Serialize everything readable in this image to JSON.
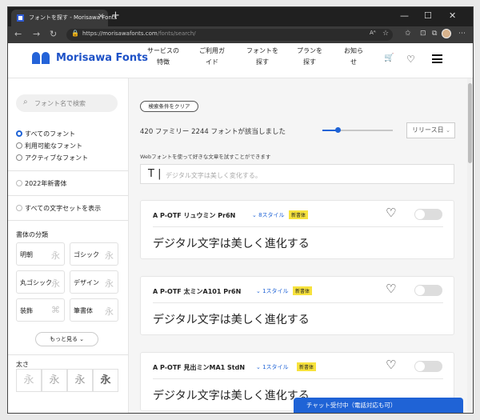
{
  "browser": {
    "tab_title": "フォントを探す - Morisawa Fonts",
    "tab_close": "×",
    "new_tab": "+",
    "win_min": "—",
    "win_max": "☐",
    "win_close": "✕",
    "back": "←",
    "forward": "→",
    "reload": "↻",
    "url_host": "https://morisawafonts.com",
    "url_path": "/fonts/search/",
    "lock": "🔒",
    "read_aloud": "Aᴬ",
    "star": "☆",
    "collections": "⊡",
    "favorites": "✩",
    "extensions": "⧉",
    "more": "⋯"
  },
  "header": {
    "logo_text": "Morisawa Fonts",
    "menu": [
      {
        "line1": "サービスの",
        "line2": "特徴"
      },
      {
        "line1": "ご利用ガ",
        "line2": "イド"
      },
      {
        "line1": "フォントを",
        "line2": "探す"
      },
      {
        "line1": "プランを",
        "line2": "探す"
      },
      {
        "line1": "お知ら",
        "line2": "せ"
      }
    ],
    "cart_icon": "🛒",
    "heart_icon": "♡"
  },
  "sidebar": {
    "search_placeholder": "フォント名で検索",
    "search_icon": "⌕",
    "filter_options": [
      "すべてのフォント",
      "利用可能なフォント",
      "アクティブなフォント"
    ],
    "selected_filter": "すべてのフォント",
    "new_fonts": "2022年新書体",
    "show_all_charsets": "すべての文字セットを表示",
    "category_title": "書体の分類",
    "categories": [
      {
        "label": "明朝",
        "glyph": "永"
      },
      {
        "label": "ゴシック",
        "glyph": "永"
      },
      {
        "label": "丸ゴシック",
        "glyph": "永"
      },
      {
        "label": "デザイン",
        "glyph": "永"
      },
      {
        "label": "装飾",
        "glyph": "⌘"
      },
      {
        "label": "筆書体",
        "glyph": "永"
      }
    ],
    "more_label": "もっと見る ⌄",
    "weight_title": "太さ",
    "weights": [
      "永",
      "永",
      "永",
      "永"
    ]
  },
  "main": {
    "clear_button": "検索条件をクリア",
    "result_count": "420 ファミリー 2244 フォントが該当しました",
    "sort_label": "リリース日",
    "sort_arrow": "⌄",
    "trial_hint": "Webフォントを使って好きな文章を試すことができます",
    "trial_prefix": "T |",
    "trial_placeholder": "デジタル文字は美しく変化する。",
    "cards": [
      {
        "name": "A P-OTF リュウミン Pr6N",
        "styles": "⌄ 8スタイル",
        "badge": "新書体",
        "sample": "デジタル文字は美しく進化する"
      },
      {
        "name": "A P-OTF 太ミンA101 Pr6N",
        "styles": "⌄ 1スタイル",
        "badge": "新書体",
        "sample": "デジタル文字は美しく進化する"
      },
      {
        "name": "A P-OTF 見出ミンMA1 StdN",
        "styles": "⌄ 1スタイル",
        "badge": "新書体",
        "sample": "デジタル文字は美しく進化する"
      }
    ],
    "heart_icon": "♡",
    "chat_label": "チャット受付中（電話対応も可）"
  },
  "colors": {
    "brand": "#1e52c7",
    "accent": "#1f63d6",
    "badge": "#f7e23c"
  }
}
